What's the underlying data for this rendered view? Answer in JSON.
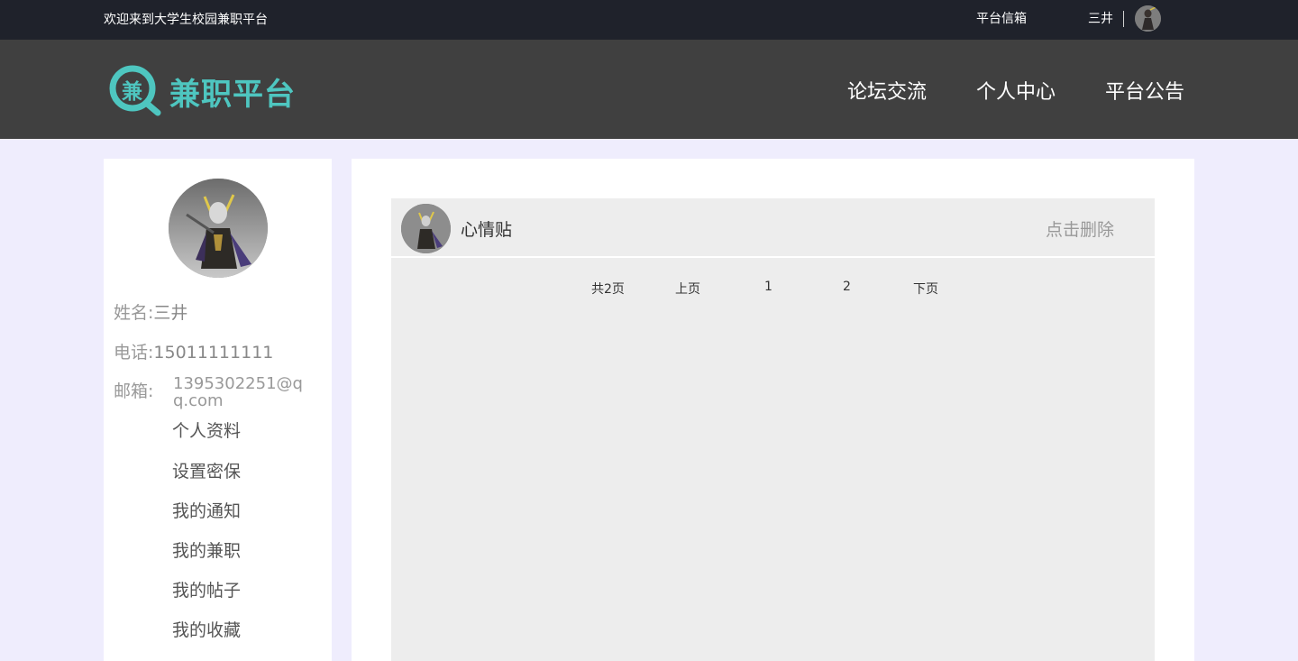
{
  "topbar": {
    "welcome": "欢迎来到大学生校园兼职平台",
    "mailbox": "平台信箱",
    "username": "三井"
  },
  "header": {
    "logo_char": "兼",
    "logo_text": "兼职平台",
    "nav": [
      "论坛交流",
      "个人中心",
      "平台公告"
    ]
  },
  "profile": {
    "name_label": "姓名:",
    "name": "三井",
    "phone_label": "电话:",
    "phone": "15011111111",
    "email_label": "邮箱:",
    "email": "1395302251@qq.com"
  },
  "menu": [
    "个人资料",
    "设置密保",
    "我的通知",
    "我的兼职",
    "我的帖子",
    "我的收藏"
  ],
  "post": {
    "title": "心情贴",
    "delete": "点击删除"
  },
  "pager": {
    "total": "共2页",
    "prev": "上页",
    "pages": [
      "1",
      "2"
    ],
    "next": "下页"
  },
  "colors": {
    "topbar_bg": "#1f222b",
    "header_bg": "#404040",
    "brand": "#4ec6c0",
    "page_bg": "#efedfd",
    "panel_bg": "#ededed"
  }
}
